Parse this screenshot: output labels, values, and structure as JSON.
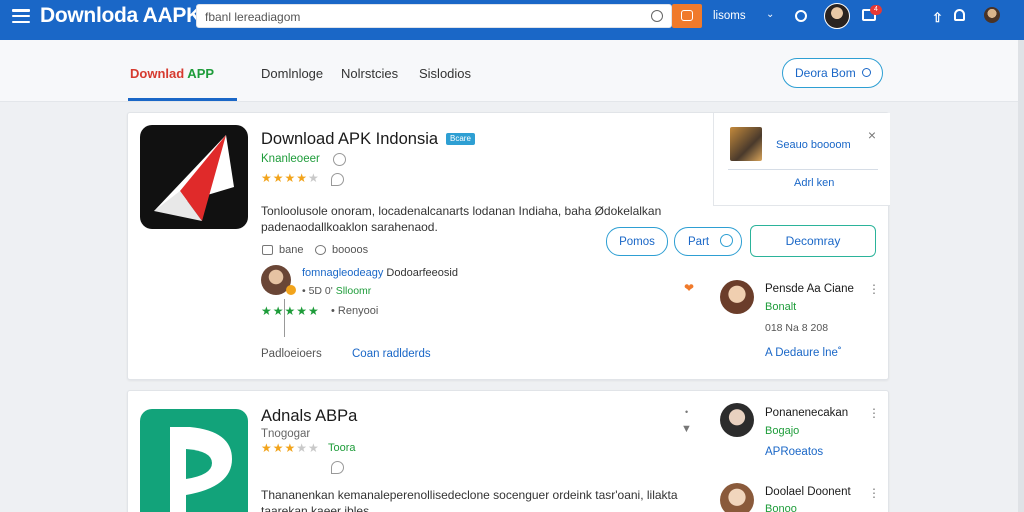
{
  "topbar": {
    "brand": "Downloda AAPK",
    "search_value": "fbanl lereadiagom",
    "nav_link": "lisoms",
    "nav_caret": "⌄",
    "notif_count": "4"
  },
  "subnav": {
    "brand_red": "Downlad",
    "brand_green": " APP",
    "tab2": "Domlnloge",
    "tab3": "Nolrstcies",
    "tab4": "Sislodios",
    "search_label": "Deora Bom"
  },
  "card1": {
    "title": "Download APK Indonsia",
    "tag": "Bcare",
    "developer": "Knanleoeer",
    "rating": 4,
    "stars_on": "★★★★",
    "stars_off": "★",
    "description": "Tonloolusole onoram, locadenalcanarts lodanan Indiaha, baha Ødokelalkan padenaodallkoaklon sarahenaod.",
    "meta1": "bane",
    "meta2": "boooos",
    "btn_primary": "Pomos",
    "btn_part": "Part",
    "btn_download": "Decomray",
    "popup": {
      "text": "Seauo boooom",
      "close": "×",
      "link": "Adrl ken"
    },
    "review": {
      "name": "fomnagleodeagy",
      "name_rest": " Dodoarfeeosid",
      "sub_a": "• 5D  0'",
      "sub_b": " Slloomr",
      "stars": "★★★★★",
      "remark": "•  Renyooi"
    },
    "footer_a": "Padloeioers",
    "footer_b": "Coan radlderds",
    "side": {
      "name": "Pensde Aa Ciane",
      "sub": "Bonalt",
      "date": "018  Na 8 208",
      "link": "A Dedaure lne˚"
    }
  },
  "card2": {
    "title": "Adnals ABPa",
    "developer": "Tnogogar",
    "developer_sub": "Toora",
    "rating": 3,
    "stars_on": "★★★",
    "stars_off": "★★",
    "description": "Thananenkan kemanaleperenollisedeclone socenguer ordeink tasr'oani, lilakta taarekan kaeer ibles",
    "side1": {
      "name": "Ponanenecakan",
      "sub": "Bogajo",
      "link": "APRoeatos"
    },
    "side2": {
      "name": "Doolael Doonent",
      "sub": "Bonoo"
    }
  },
  "colors": {
    "topbar": "#1a67c7",
    "accent_orange": "#f07a2b",
    "accent_green": "#1e9c3a",
    "link_blue": "#1a67c7",
    "star": "#f2a41c"
  }
}
